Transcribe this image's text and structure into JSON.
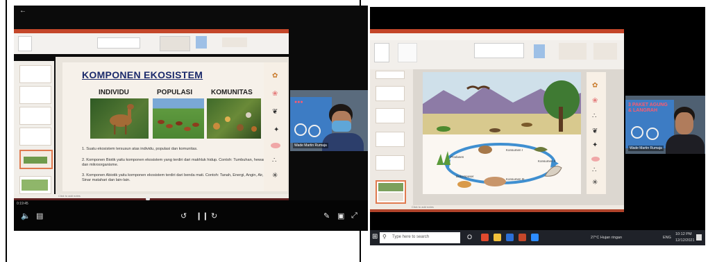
{
  "left_window": {
    "slide": {
      "title": "KOMPONEN EKOSISTEM",
      "columns": [
        "INDIVIDU",
        "POPULASI",
        "KOMUNITAS"
      ],
      "points": [
        {
          "num": "1.",
          "text": "Suatu ekosistem tersusun atas individu, populasi dan komunitas."
        },
        {
          "num": "2.",
          "text": "Komponen Biotik yaitu komponen ekosistem yang terdiri dari makhluk hidup. Contoh: Tumbuhan, hewan, manusia dan mikroorganisme."
        },
        {
          "num": "3.",
          "text": "Komponen Abiotik yaitu komponen ekosistem terdiri dari benda mati. Contoh: Tanah, Energi, Angin, Air, Suhu, Sinar matahari dan lain-lain."
        }
      ]
    },
    "notes": "Click to add notes",
    "time_elapsed": "0:19:45",
    "webcam_name": "Wade Martin Rumaja"
  },
  "right_window": {
    "slide_labels": {
      "produsen": "Produsen",
      "konsumen1": "Konsumen I",
      "konsumen2": "Konsumen II",
      "konsumen3": "Konsumen III",
      "dekomposer": "Dekomposer"
    },
    "notes": "Click to add notes",
    "webcam_poster": "3 PAKET AGUNG\n& LANGRAH",
    "webcam_name": "Wade Martin Rumaja",
    "taskbar": {
      "search_placeholder": "Type here to search",
      "weather": "27°C Hujan ringan",
      "lang": "ENG",
      "time": "10:12 PM",
      "date": "12/12/2021"
    }
  },
  "colors": {
    "ppt_red": "#c4472a",
    "title_blue": "#1b2a6b",
    "taskbar": "#1f2229"
  }
}
